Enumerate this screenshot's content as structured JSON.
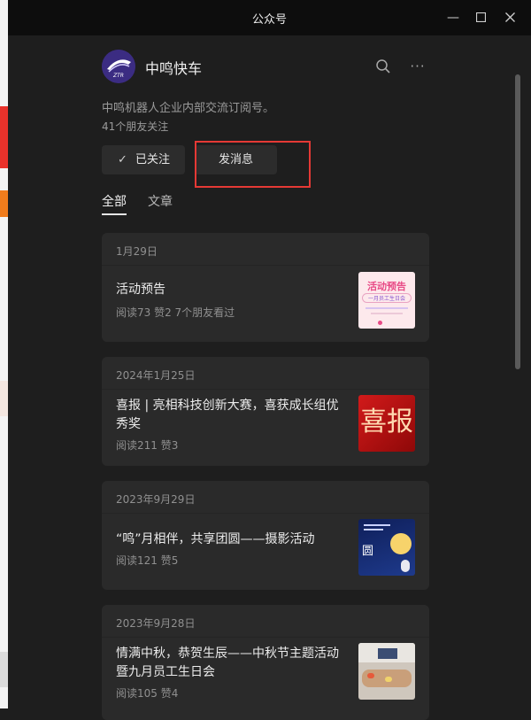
{
  "window": {
    "title": "公众号"
  },
  "account": {
    "name": "中鸣快车",
    "description": "中鸣机器人企业内部交流订阅号。",
    "followers": "41个朋友关注",
    "avatar_text": "ZTR"
  },
  "actions": {
    "follow_label": "已关注",
    "message_label": "发消息"
  },
  "tabs": [
    {
      "label": "全部"
    },
    {
      "label": "文章"
    }
  ],
  "articles": [
    {
      "date": "1月29日",
      "title": "活动预告",
      "stats": "阅读73  赞2  7个朋友看过",
      "thumb_text": "活动预告",
      "thumb_sub": "一月员工生日会"
    },
    {
      "date": "2024年1月25日",
      "title": "喜报 | 亮相科技创新大赛，喜获成长组优秀奖",
      "stats": "阅读211  赞3",
      "thumb_text": "喜报"
    },
    {
      "date": "2023年9月29日",
      "title": "“鸣”月相伴，共享团圆——摄影活动",
      "stats": "阅读121  赞5",
      "thumb_text": "圆"
    },
    {
      "date": "2023年9月28日",
      "title": "情满中秋，恭贺生辰——中秋节主题活动暨九月员工生日会",
      "stats": "阅读105  赞4"
    }
  ],
  "colors": {
    "accent_highlight": "#e53935",
    "background": "#1e1e1e",
    "card": "#2a2a2a"
  }
}
